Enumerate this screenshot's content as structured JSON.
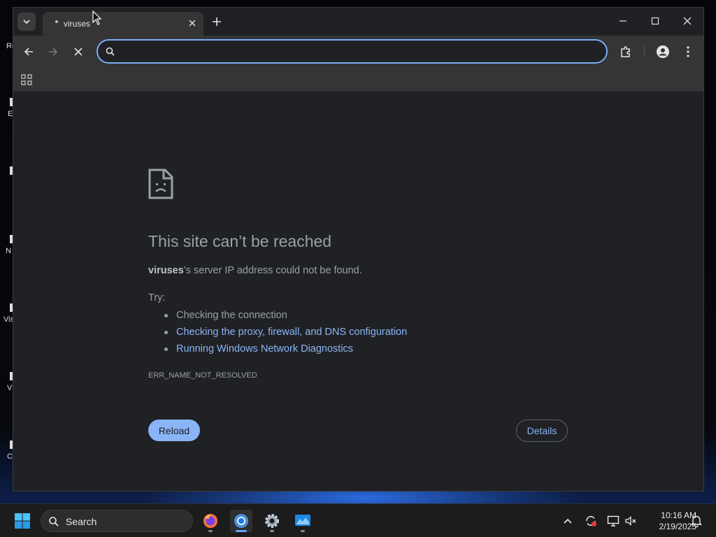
{
  "desktop": {
    "icon_labels": [
      "Re",
      "E",
      "N",
      "Vis",
      "V",
      "C"
    ]
  },
  "browser": {
    "tab": {
      "title": "viruses"
    },
    "omnibox": {
      "value": "",
      "placeholder": ""
    },
    "window_controls": [
      "minimize",
      "maximize",
      "close"
    ]
  },
  "error_page": {
    "title": "This site can’t be reached",
    "host": "viruses",
    "desc_rest": "’s server IP address could not be found.",
    "try_label": "Try:",
    "suggestions": [
      {
        "text": "Checking the connection",
        "link": false
      },
      {
        "text": "Checking the proxy, firewall, and DNS configuration",
        "link": true
      },
      {
        "text": "Running Windows Network Diagnostics",
        "link": true
      }
    ],
    "error_code": "ERR_NAME_NOT_RESOLVED",
    "reload_label": "Reload",
    "details_label": "Details"
  },
  "taskbar": {
    "search_label": "Search",
    "apps": [
      "firefox-icon",
      "chrome-icon",
      "settings-icon",
      "app-icon"
    ],
    "time": "10:16 AM",
    "date": "2/19/2025"
  },
  "colors": {
    "accent": "#8ab4f8",
    "page_bg": "#202124",
    "toolbar_bg": "#353535",
    "text_muted": "#9aa0a6"
  }
}
